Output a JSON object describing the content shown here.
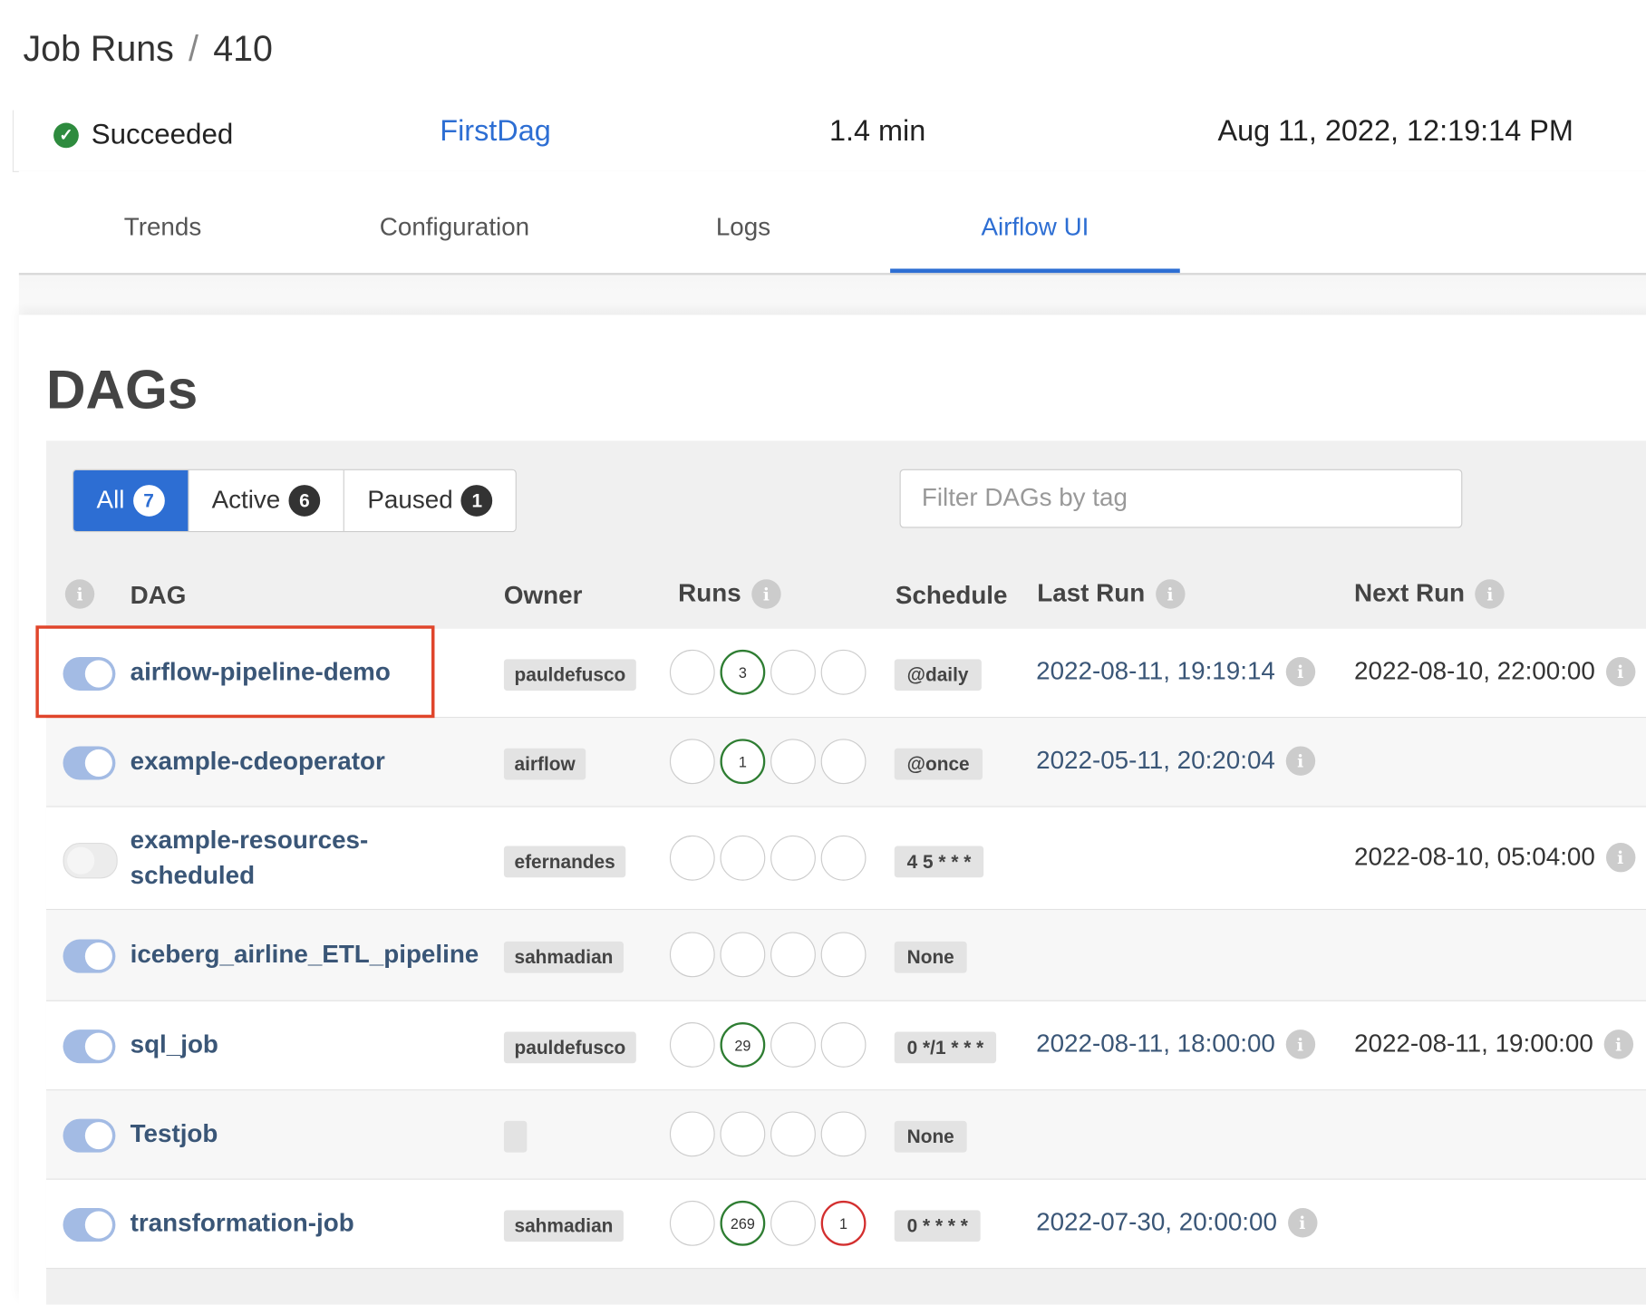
{
  "breadcrumb": {
    "parent": "Job Runs",
    "separator": "/",
    "current": "410"
  },
  "summary": {
    "status": "Succeeded",
    "job_name": "FirstDag",
    "duration": "1.4 min",
    "timestamp": "Aug 11, 2022, 12:19:14 PM",
    "status_color": "#2e8b3e"
  },
  "tabs": [
    "Trends",
    "Configuration",
    "Logs",
    "Airflow UI"
  ],
  "active_tab": "Airflow UI",
  "dags": {
    "title": "DAGs",
    "filters": [
      {
        "label": "All",
        "count": "7",
        "active": true
      },
      {
        "label": "Active",
        "count": "6"
      },
      {
        "label": "Paused",
        "count": "1"
      }
    ],
    "tag_filter_placeholder": "Filter DAGs by tag",
    "columns": {
      "dag": "DAG",
      "owner": "Owner",
      "runs": "Runs",
      "schedule": "Schedule",
      "last_run": "Last Run",
      "next_run": "Next Run"
    },
    "rows": [
      {
        "name": "airflow-pipeline-demo",
        "on": true,
        "owner": "pauldefusco",
        "runs": [
          "",
          "3",
          "",
          ""
        ],
        "run_states": [
          "",
          "success",
          "",
          ""
        ],
        "schedule": "@daily",
        "last_run": "2022-08-11, 19:19:14",
        "next_run": "2022-08-10, 22:00:00"
      },
      {
        "name": "example-cdeoperator",
        "on": true,
        "owner": "airflow",
        "runs": [
          "",
          "1",
          "",
          ""
        ],
        "run_states": [
          "",
          "success",
          "",
          ""
        ],
        "schedule": "@once",
        "last_run": "2022-05-11, 20:20:04",
        "next_run": ""
      },
      {
        "name_line1": "example-resources-",
        "name_line2": "scheduled",
        "on": false,
        "owner": "efernandes",
        "runs": [
          "",
          "",
          "",
          ""
        ],
        "run_states": [
          "",
          "",
          "",
          ""
        ],
        "schedule": "4 5 * * *",
        "last_run": "",
        "next_run": "2022-08-10, 05:04:00"
      },
      {
        "name": "iceberg_airline_ETL_pipeline",
        "on": true,
        "owner": "sahmadian",
        "runs": [
          "",
          "",
          "",
          ""
        ],
        "run_states": [
          "",
          "",
          "",
          ""
        ],
        "schedule": "None",
        "last_run": "",
        "next_run": ""
      },
      {
        "name": "sql_job",
        "on": true,
        "owner": "pauldefusco",
        "runs": [
          "",
          "29",
          "",
          ""
        ],
        "run_states": [
          "",
          "success",
          "",
          ""
        ],
        "schedule": "0 */1 * * *",
        "last_run": "2022-08-11, 18:00:00",
        "next_run": "2022-08-11, 19:00:00"
      },
      {
        "name": "Testjob",
        "on": true,
        "owner": "",
        "runs": [
          "",
          "",
          "",
          ""
        ],
        "run_states": [
          "",
          "",
          "",
          ""
        ],
        "schedule": "None",
        "last_run": "",
        "next_run": ""
      },
      {
        "name": "transformation-job",
        "on": true,
        "owner": "sahmadian",
        "runs": [
          "",
          "269",
          "",
          "1"
        ],
        "run_states": [
          "",
          "success",
          "",
          "failed"
        ],
        "schedule": "0 * * * *",
        "last_run": "2022-07-30, 20:00:00",
        "next_run": ""
      }
    ]
  },
  "colors": {
    "accent": "#2d6ed3",
    "success": "#2e7d32",
    "failed": "#d32f2f",
    "highlight": "#e0452b"
  },
  "icons": {
    "status": "check-circle-icon",
    "info": "info-icon"
  }
}
